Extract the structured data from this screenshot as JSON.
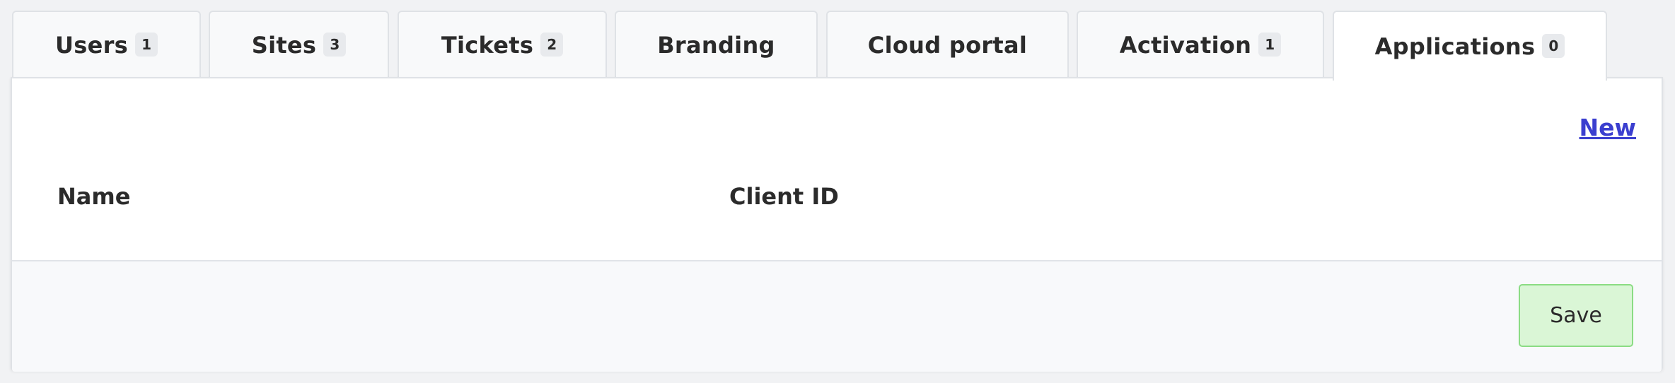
{
  "tabs": [
    {
      "label": "Users",
      "count": "1",
      "active": false
    },
    {
      "label": "Sites",
      "count": "3",
      "active": false
    },
    {
      "label": "Tickets",
      "count": "2",
      "active": false
    },
    {
      "label": "Branding",
      "count": null,
      "active": false
    },
    {
      "label": "Cloud portal",
      "count": null,
      "active": false
    },
    {
      "label": "Activation",
      "count": "1",
      "active": false
    },
    {
      "label": "Applications",
      "count": "0",
      "active": true
    }
  ],
  "panel": {
    "new_link": "New",
    "columns": {
      "name": "Name",
      "client_id": "Client ID"
    }
  },
  "footer": {
    "save_label": "Save"
  },
  "colors": {
    "link": "#3b3fcf",
    "save_bg": "#daf6d6",
    "save_border": "#8bdc84"
  }
}
